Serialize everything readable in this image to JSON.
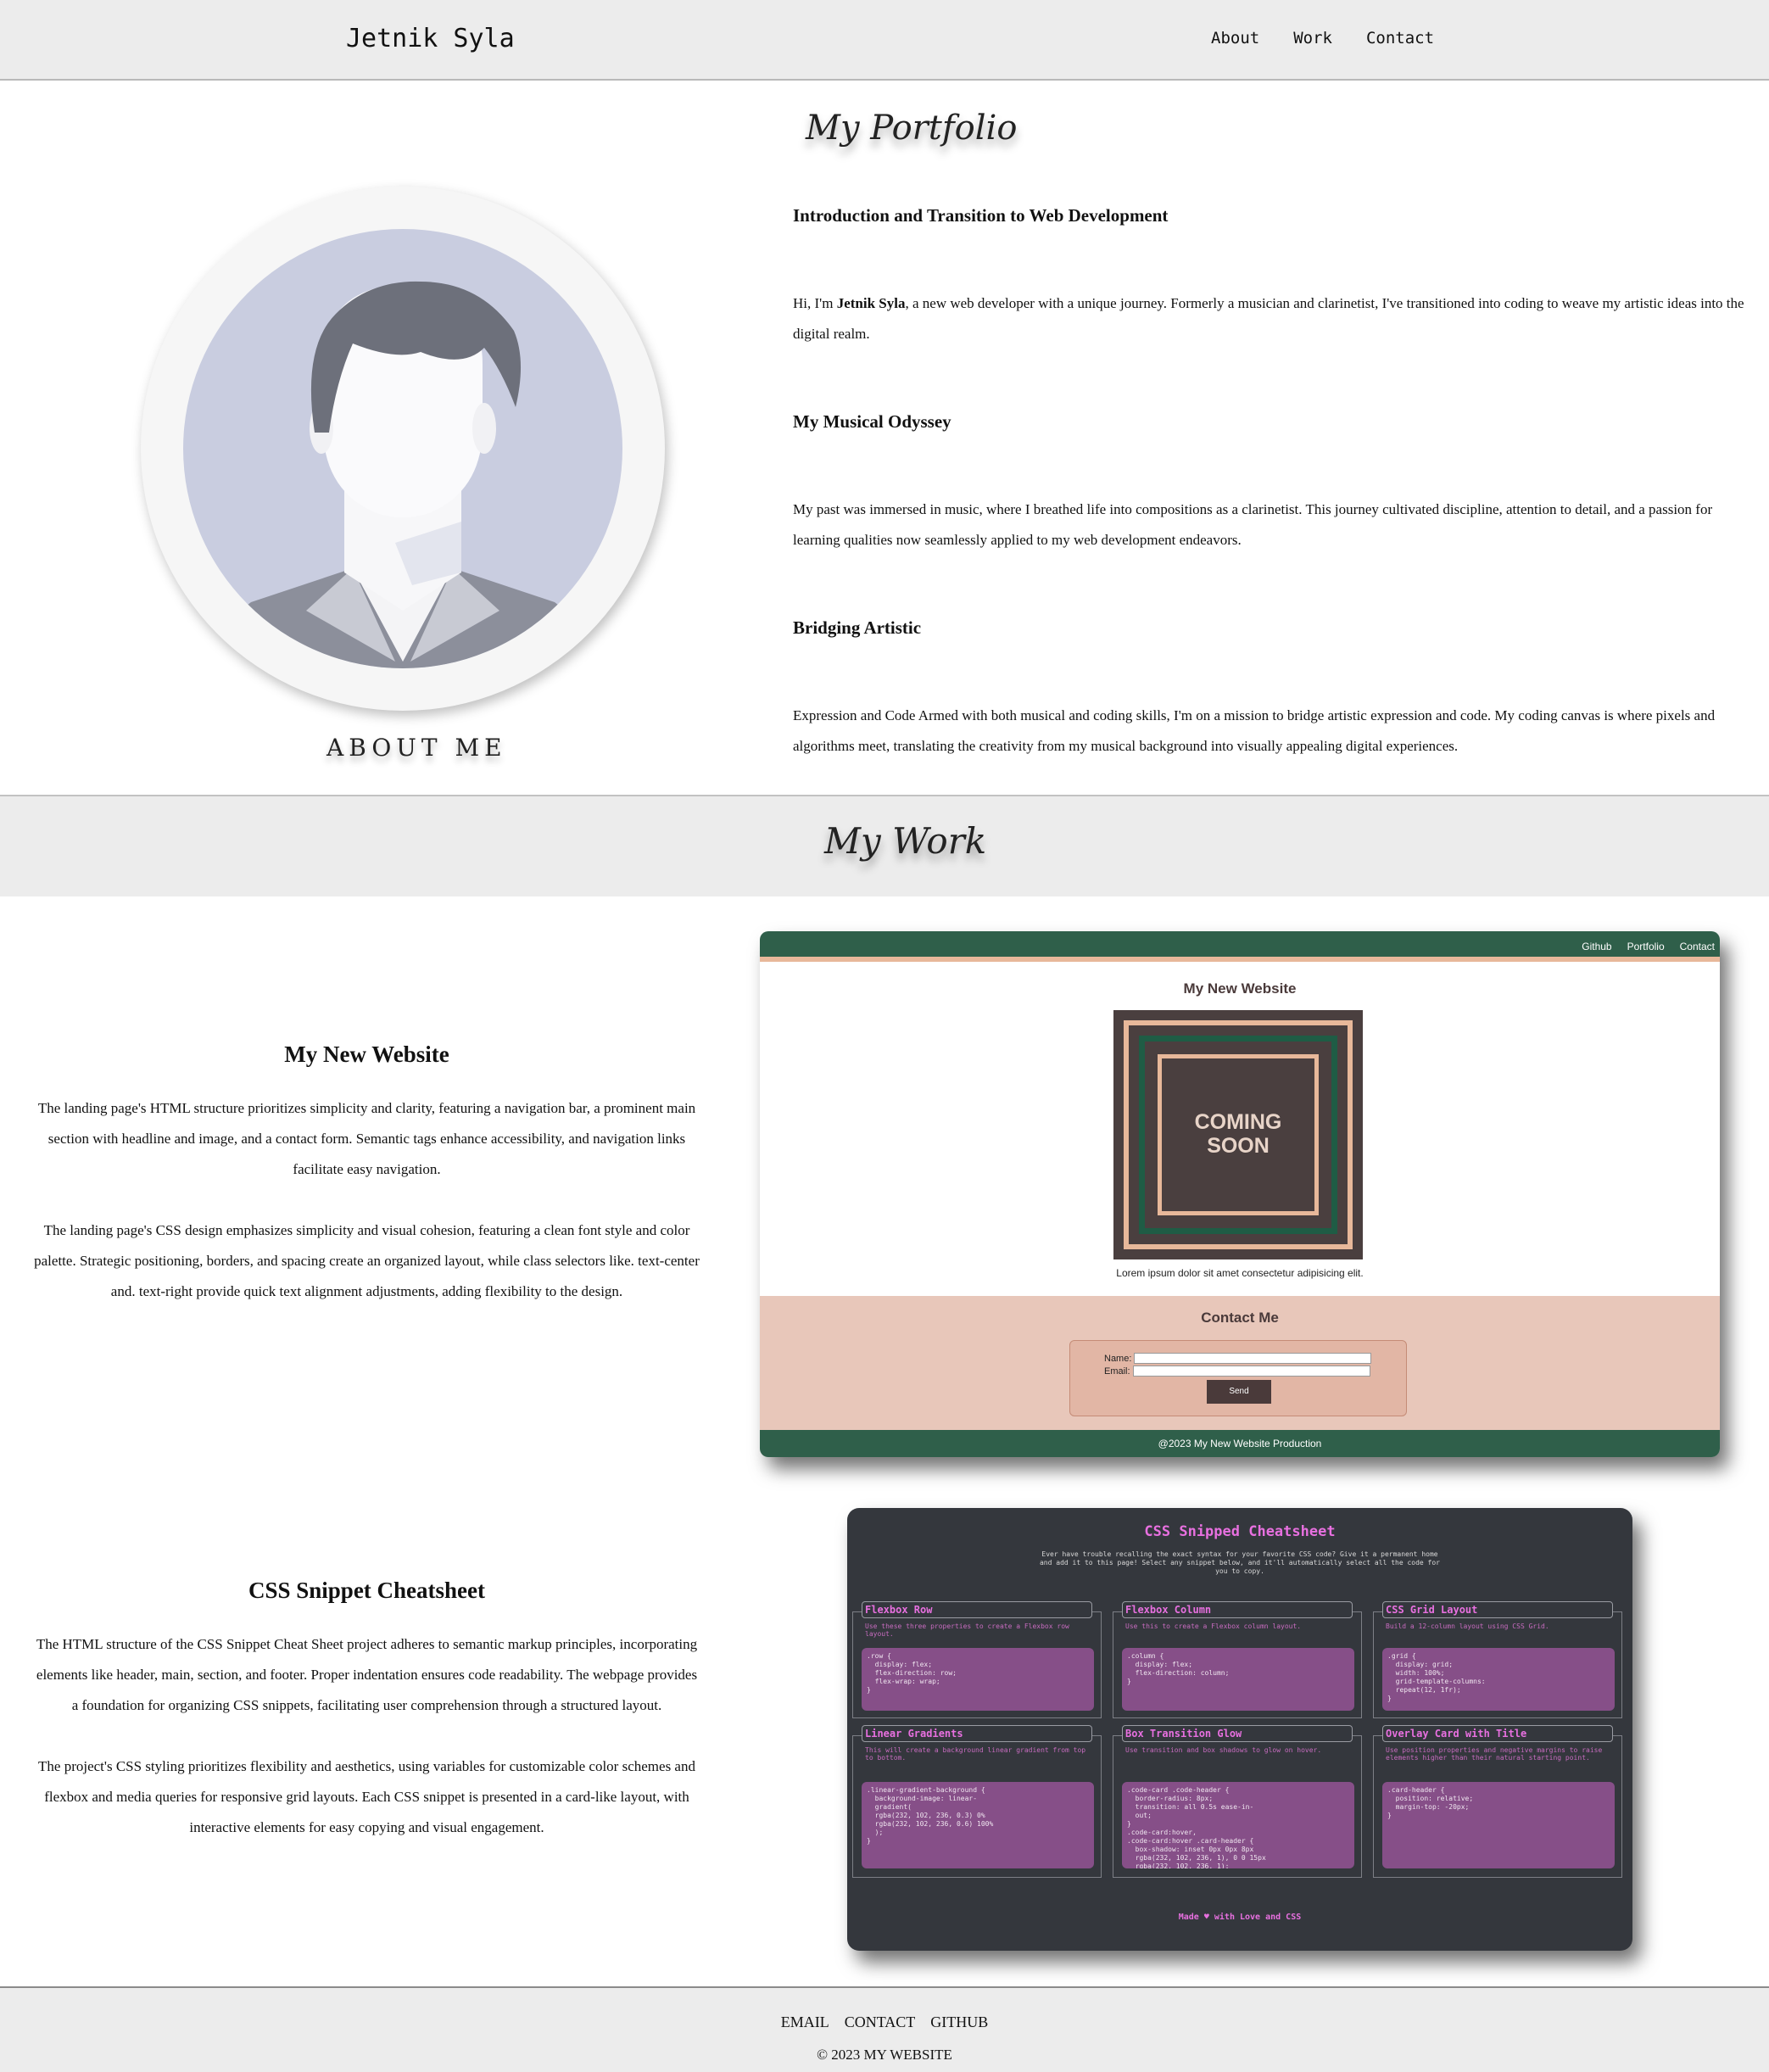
{
  "header": {
    "brand": "Jetnik Syla",
    "nav": [
      "About",
      "Work",
      "Contact"
    ]
  },
  "portfolio": {
    "title": "My Portfolio",
    "about_label": "ABOUT ME",
    "sections": [
      {
        "heading": "Introduction and Transition to Web Development",
        "text_before": "Hi, I'm ",
        "text_bold": "Jetnik Syla",
        "text_after": ", a new web developer with a unique journey. Formerly a musician and clarinetist, I've transitioned into coding to weave my artistic ideas into the digital realm."
      },
      {
        "heading": "My Musical Odyssey",
        "text": "My past was immersed in music, where I breathed life into compositions as a clarinetist. This journey cultivated discipline, attention to detail, and a passion for learning qualities now seamlessly applied to my web development endeavors."
      },
      {
        "heading": "Bridging Artistic",
        "text": "Expression and Code Armed with both musical and coding skills, I'm on a mission to bridge artistic expression and code. My coding canvas is where pixels and algorithms meet, translating the creativity from my musical background into visually appealing digital experiences."
      }
    ]
  },
  "work": {
    "title": "My Work",
    "projects": [
      {
        "title": "My New Website",
        "paragraphs": [
          "The landing page's HTML structure prioritizes simplicity and clarity, featuring a navigation bar, a prominent main section with headline and image, and a contact form. Semantic tags enhance accessibility, and navigation links facilitate easy navigation.",
          "The landing page's CSS design emphasizes simplicity and visual cohesion, featuring a clean font style and color palette. Strategic positioning, borders, and spacing create an organized layout, while class selectors like. text-center and. text-right provide quick text alignment adjustments, adding flexibility to the design."
        ],
        "preview": {
          "nav": [
            "Github",
            "Portfolio",
            "Contact"
          ],
          "title": "My New Website",
          "image_text": [
            "COMING",
            "SOON"
          ],
          "caption": "Lorem ipsum dolor sit amet consectetur adipisicing elit.",
          "contact_heading": "Contact Me",
          "name_label": "Name:",
          "email_label": "Email:",
          "send_label": "Send",
          "footer": "@2023 My New Website Production"
        }
      },
      {
        "title": "CSS Snippet Cheatsheet",
        "paragraphs": [
          "The HTML structure of the CSS Snippet Cheat Sheet project adheres to semantic markup principles, incorporating elements like header, main, section, and footer. Proper indentation ensures code readability. The webpage provides a foundation for organizing CSS snippets, facilitating user comprehension through a structured layout.",
          "The project's CSS styling prioritizes flexibility and aesthetics, using variables for customizable color schemes and flexbox and media queries for responsive grid layouts. Each CSS snippet is presented in a card-like layout, with interactive elements for easy copying and visual engagement."
        ],
        "preview": {
          "title": "CSS Snipped Cheatsheet",
          "subtitle": "Ever have trouble recalling the exact syntax for your favorite CSS code? Give it a permanent home and add it to this page! Select any snippet below, and it'll automatically select all the code for you to copy.",
          "cards": [
            {
              "title": "Flexbox Row",
              "desc": "Use these three properties to create a Flexbox row layout.",
              "code": ".row {\n  display: flex;\n  flex-direction: row;\n  flex-wrap: wrap;\n}"
            },
            {
              "title": "Flexbox Column",
              "desc": "Use this to create a Flexbox column layout.",
              "code": ".column {\n  display: flex;\n  flex-direction: column;\n}"
            },
            {
              "title": "CSS Grid Layout",
              "desc": "Build a 12-column layout using CSS Grid.",
              "code": ".grid {\n  display: grid;\n  width: 100%;\n  grid-template-columns:\n  repeat(12, 1fr);\n}"
            },
            {
              "title": "Linear Gradients",
              "desc": "This will create a background linear gradient from top to bottom.",
              "code": ".linear-gradient-background {\n  background-image: linear-\n  gradient(\n  rgba(232, 102, 236, 0.3) 0%\n  rgba(232, 102, 236, 0.6) 100%\n  );\n}"
            },
            {
              "title": "Box Transition Glow",
              "desc": "Use transition and box shadows to glow on hover.",
              "code": ".code-card .code-header {\n  border-radius: 8px;\n  transition: all 0.5s ease-in-\n  out;\n}\n.code-card:hover,\n.code-card:hover .card-header {\n  box-shadow: inset 0px 0px 8px\n  rgba(232, 102, 236, 1), 0 0 15px\n  rgba(232, 102, 236, 1);\n}"
            },
            {
              "title": "Overlay Card with Title",
              "desc": "Use position properties and negative margins to raise elements higher than their natural starting point.",
              "code": ".card-header {\n  position: relative;\n  margin-top: -20px;\n}"
            }
          ],
          "footer": "Made ♥ with Love and CSS"
        }
      }
    ]
  },
  "footer": {
    "links": [
      "EMAIL",
      "CONTACT",
      "GITHUB"
    ],
    "copyright": "© 2023 MY WEBSITE"
  }
}
